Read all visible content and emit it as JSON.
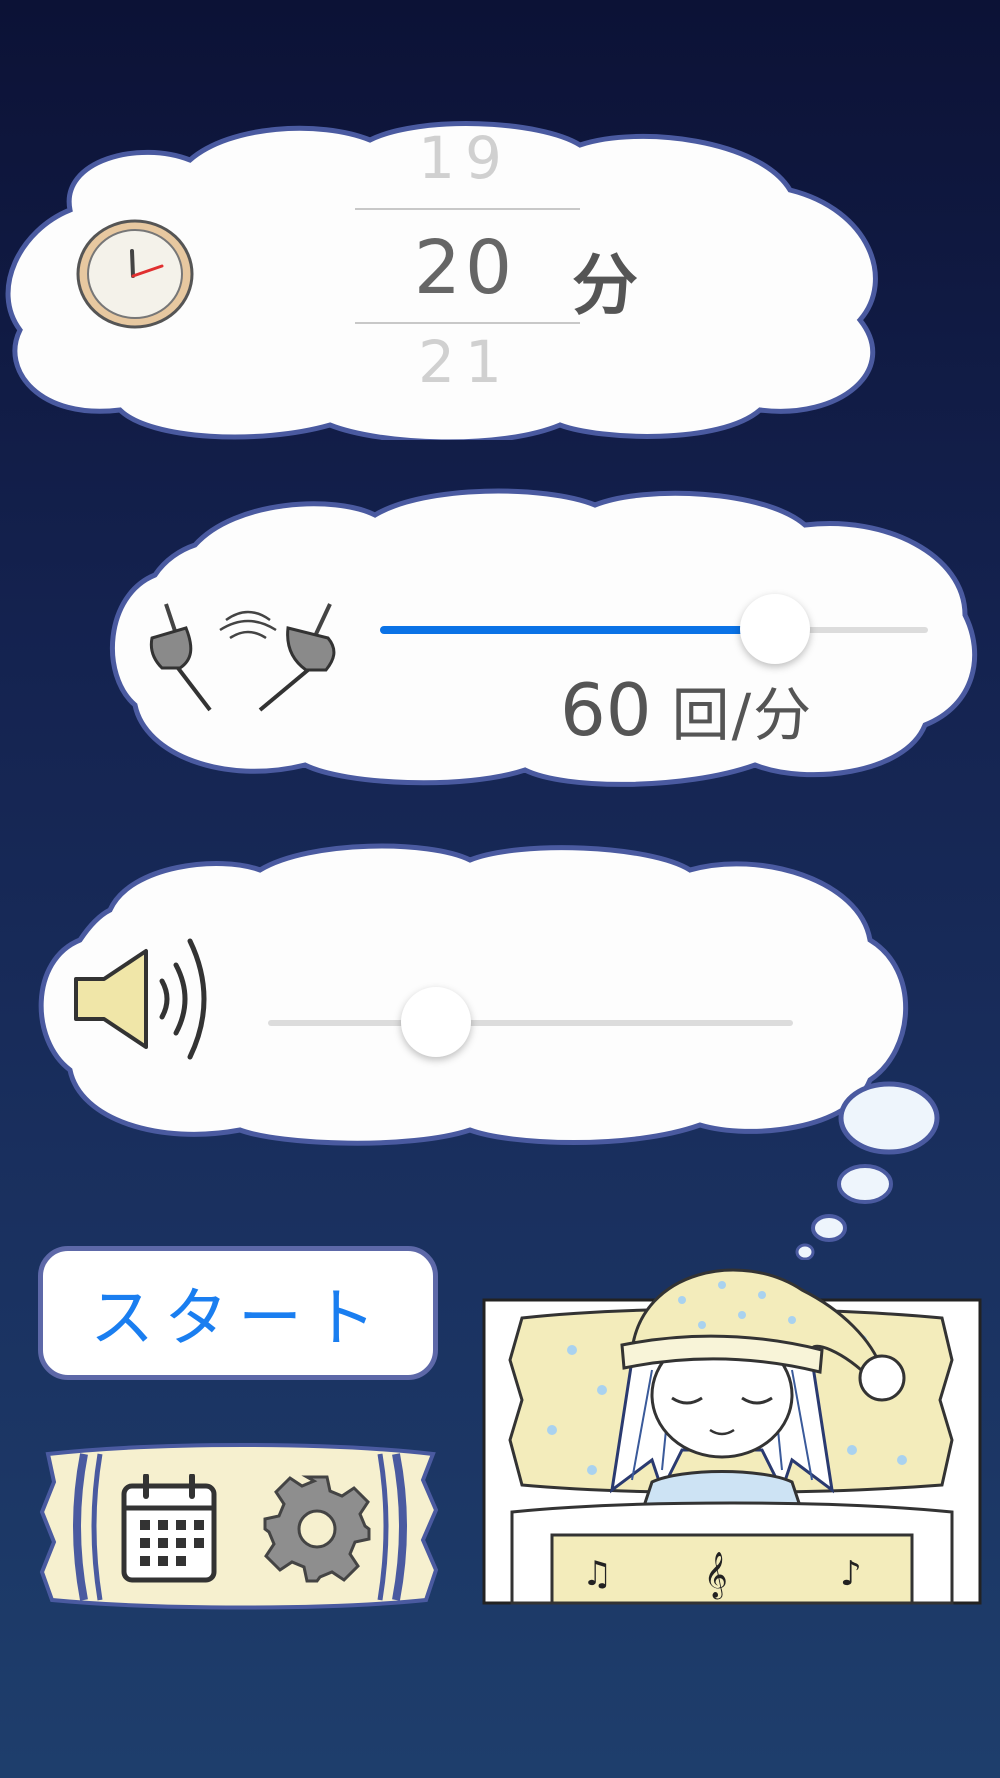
{
  "timer": {
    "prev_value": "19",
    "current_value": "20",
    "next_value": "21",
    "unit_label": "分"
  },
  "tempo": {
    "value_label": "60",
    "unit_label": "回/分",
    "slider_fraction": 0.72
  },
  "volume": {
    "slider_fraction": 0.32
  },
  "actions": {
    "start_label": "スタート"
  },
  "icons": {
    "timer": "clock-icon",
    "tempo": "swinging-pendulums-icon",
    "volume": "speaker-icon",
    "calendar": "calendar-icon",
    "settings": "gear-icon"
  },
  "colors": {
    "accent": "#0a72e6",
    "cloud_fill": "#ffffff",
    "cloud_stroke": "#4a5aa0",
    "background_top": "#0c1236",
    "background_bottom": "#1e3e6c"
  }
}
